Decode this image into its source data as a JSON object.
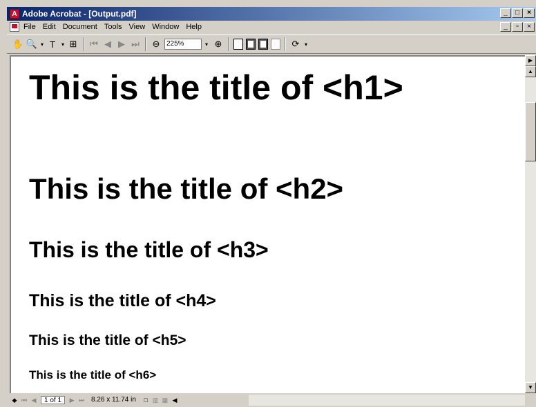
{
  "window": {
    "title": "Adobe Acrobat - [Output.pdf]",
    "buttons": [
      "_",
      "□",
      "×"
    ]
  },
  "menu": {
    "items": [
      "File",
      "Edit",
      "Document",
      "Tools",
      "View",
      "Window",
      "Help"
    ],
    "buttons": [
      "_",
      "▫",
      "×"
    ]
  },
  "toolbar": {
    "zoom_value": "225%"
  },
  "document": {
    "headings": [
      "This is the title of <h1>",
      "This is the title of <h2>",
      "This is the title of <h3>",
      "This is the title of <h4>",
      "This is the title of <h5>",
      "This is the title of <h6>"
    ]
  },
  "status": {
    "page": "1 of 1",
    "page_size": "8.26 x 11.74 in"
  }
}
